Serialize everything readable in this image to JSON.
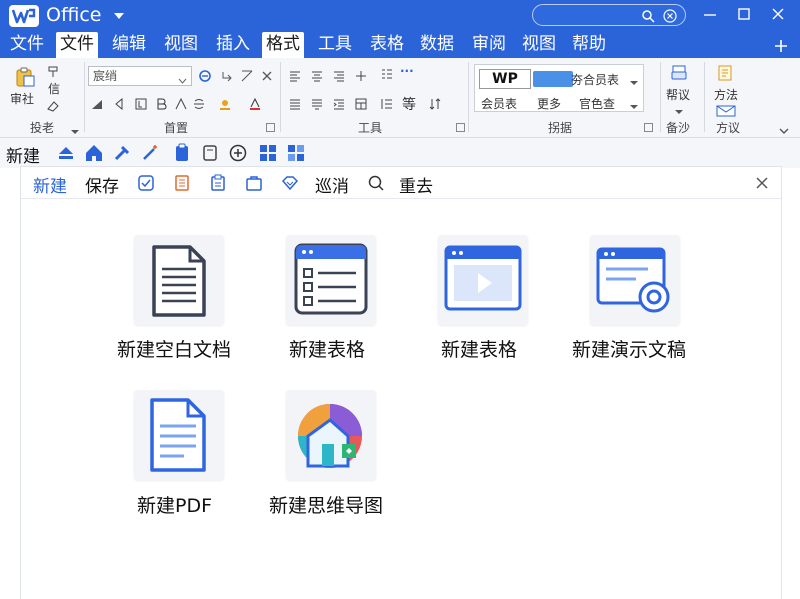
{
  "titlebar": {
    "app_name": "Office",
    "search_placeholder": ""
  },
  "menu": {
    "items": [
      {
        "label": "文件"
      },
      {
        "label": "文件"
      },
      {
        "label": "编辑"
      },
      {
        "label": "视图"
      },
      {
        "label": "插入"
      },
      {
        "label": "格式"
      },
      {
        "label": "工具"
      },
      {
        "label": "表格"
      },
      {
        "label": "数据"
      },
      {
        "label": "审阅"
      },
      {
        "label": "视图"
      },
      {
        "label": "帮助"
      }
    ]
  },
  "ribbon": {
    "g1": {
      "big_label": "审社",
      "small1": "信",
      "group": "投老"
    },
    "font": {
      "value": "宸绡",
      "group": "首置"
    },
    "para": {
      "big": "等",
      "group": "工具"
    },
    "gallery": {
      "thumb_text": "WP",
      "item1": "会员表",
      "item2": "更多",
      "item3": "官色查",
      "item4": "夯合员表",
      "group": "拐据"
    },
    "g5": {
      "label": "帮议",
      "group": "备沙"
    },
    "g6": {
      "label": "方法",
      "group": "方议"
    }
  },
  "quickbar": {
    "new_label": "新建"
  },
  "dialog": {
    "toolbar": {
      "new": "新建",
      "save": "保存",
      "patrol": "巡消",
      "reload": "重去"
    },
    "tiles": [
      {
        "label": "新建空白文档",
        "icon": "blank-document-icon"
      },
      {
        "label": "新建表格",
        "icon": "spreadsheet-list-icon"
      },
      {
        "label": "新建表格",
        "icon": "video-window-icon"
      },
      {
        "label": "新建演示文稿",
        "icon": "presentation-icon"
      },
      {
        "label": "新建PDF",
        "icon": "pdf-document-icon"
      },
      {
        "label": "新建思维导图",
        "icon": "mindmap-house-icon"
      }
    ]
  },
  "colors": {
    "brand": "#2b63d9",
    "ribbon_bg": "#f4f6fa",
    "tile_bg": "#f3f4f7"
  }
}
